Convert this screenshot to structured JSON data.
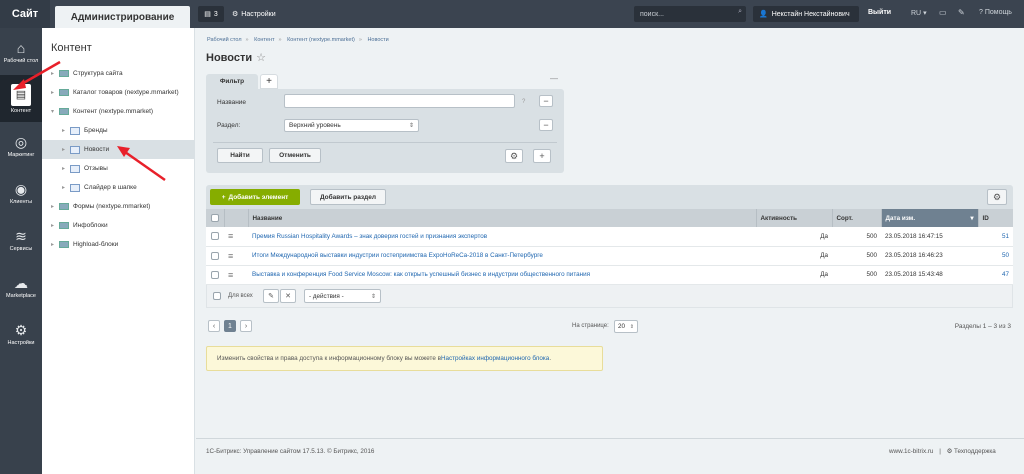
{
  "topbar": {
    "site_tab": "Сайт",
    "admin_tab": "Администрирование",
    "notifications_count": "3",
    "settings": "Настройки",
    "search_placeholder": "поиск...",
    "user": "Некстайн Некстайнович",
    "logout": "Выйти",
    "lang": "RU",
    "help": "Помощь"
  },
  "leftnav": [
    {
      "icon": "home-icon",
      "label": "Рабочий стол"
    },
    {
      "icon": "content-icon",
      "label": "Контент"
    },
    {
      "icon": "target-icon",
      "label": "Маркетинг"
    },
    {
      "icon": "clients-icon",
      "label": "Клиенты"
    },
    {
      "icon": "layers-icon",
      "label": "Сервисы"
    },
    {
      "icon": "cloud-icon",
      "label": "Marketplace"
    },
    {
      "icon": "gear-icon",
      "label": "Настройки"
    }
  ],
  "tree": {
    "title": "Контент",
    "items": [
      {
        "label": "Структура сайта"
      },
      {
        "label": "Каталог товаров (nextype.mmarket)"
      },
      {
        "label": "Контент (nextype.mmarket)"
      },
      {
        "label": "Бренды"
      },
      {
        "label": "Новости"
      },
      {
        "label": "Отзывы"
      },
      {
        "label": "Слайдер в шапке"
      },
      {
        "label": "Формы (nextype.mmarket)"
      },
      {
        "label": "Инфоблоки"
      },
      {
        "label": "Highload-блоки"
      }
    ]
  },
  "breadcrumb": [
    "Рабочий стол",
    "Контент",
    "Контент (nextype.mmarket)",
    "Новости"
  ],
  "page_title": "Новости",
  "filter": {
    "tab": "Фильтр",
    "name_label": "Название",
    "section_label": "Раздел:",
    "section_value": "Верхний уровень",
    "find": "Найти",
    "cancel": "Отменить",
    "help_mark": "?"
  },
  "grid": {
    "add_element": "Добавить элемент",
    "add_section": "Добавить раздел",
    "columns": {
      "name": "Название",
      "active": "Активность",
      "sort": "Сорт.",
      "date": "Дата изм.",
      "id": "ID"
    },
    "rows": [
      {
        "name": "Премия Russian Hospitality Awards – знак доверия гостей и признания экспертов",
        "active": "Да",
        "sort": "500",
        "date": "23.05.2018 16:47:15",
        "id": "51"
      },
      {
        "name": "Итоги Международной выставки индустрии гостеприимства ExpoHoReCa-2018 в Санкт-Петербурге",
        "active": "Да",
        "sort": "500",
        "date": "23.05.2018 16:46:23",
        "id": "50"
      },
      {
        "name": "Выставка и конференция Food Service Moscow: как открыть успешный бизнес в индустрии общественного питания",
        "active": "Да",
        "sort": "500",
        "date": "23.05.2018 15:43:48",
        "id": "47"
      }
    ],
    "for_all": "Для всех",
    "actions": "- действия -"
  },
  "pager": {
    "page": "1",
    "per_page_label": "На странице:",
    "per_page": "20",
    "summary": "Разделы 1 – 3 из 3"
  },
  "info": {
    "text": "Изменить свойства и права доступа к информационному блоку вы можете в ",
    "link": "Настройках информационного блока",
    "end": "."
  },
  "footer": {
    "copyright": "1С-Битрикс: Управление сайтом 17.5.13. © Битрикс, 2016",
    "site": "www.1c-bitrix.ru",
    "sep": "|",
    "support": "Техподдержка"
  },
  "colors": {
    "accent_green": "#86ad00",
    "annotation_arrow": "#e8202a",
    "link": "#2067b0"
  }
}
